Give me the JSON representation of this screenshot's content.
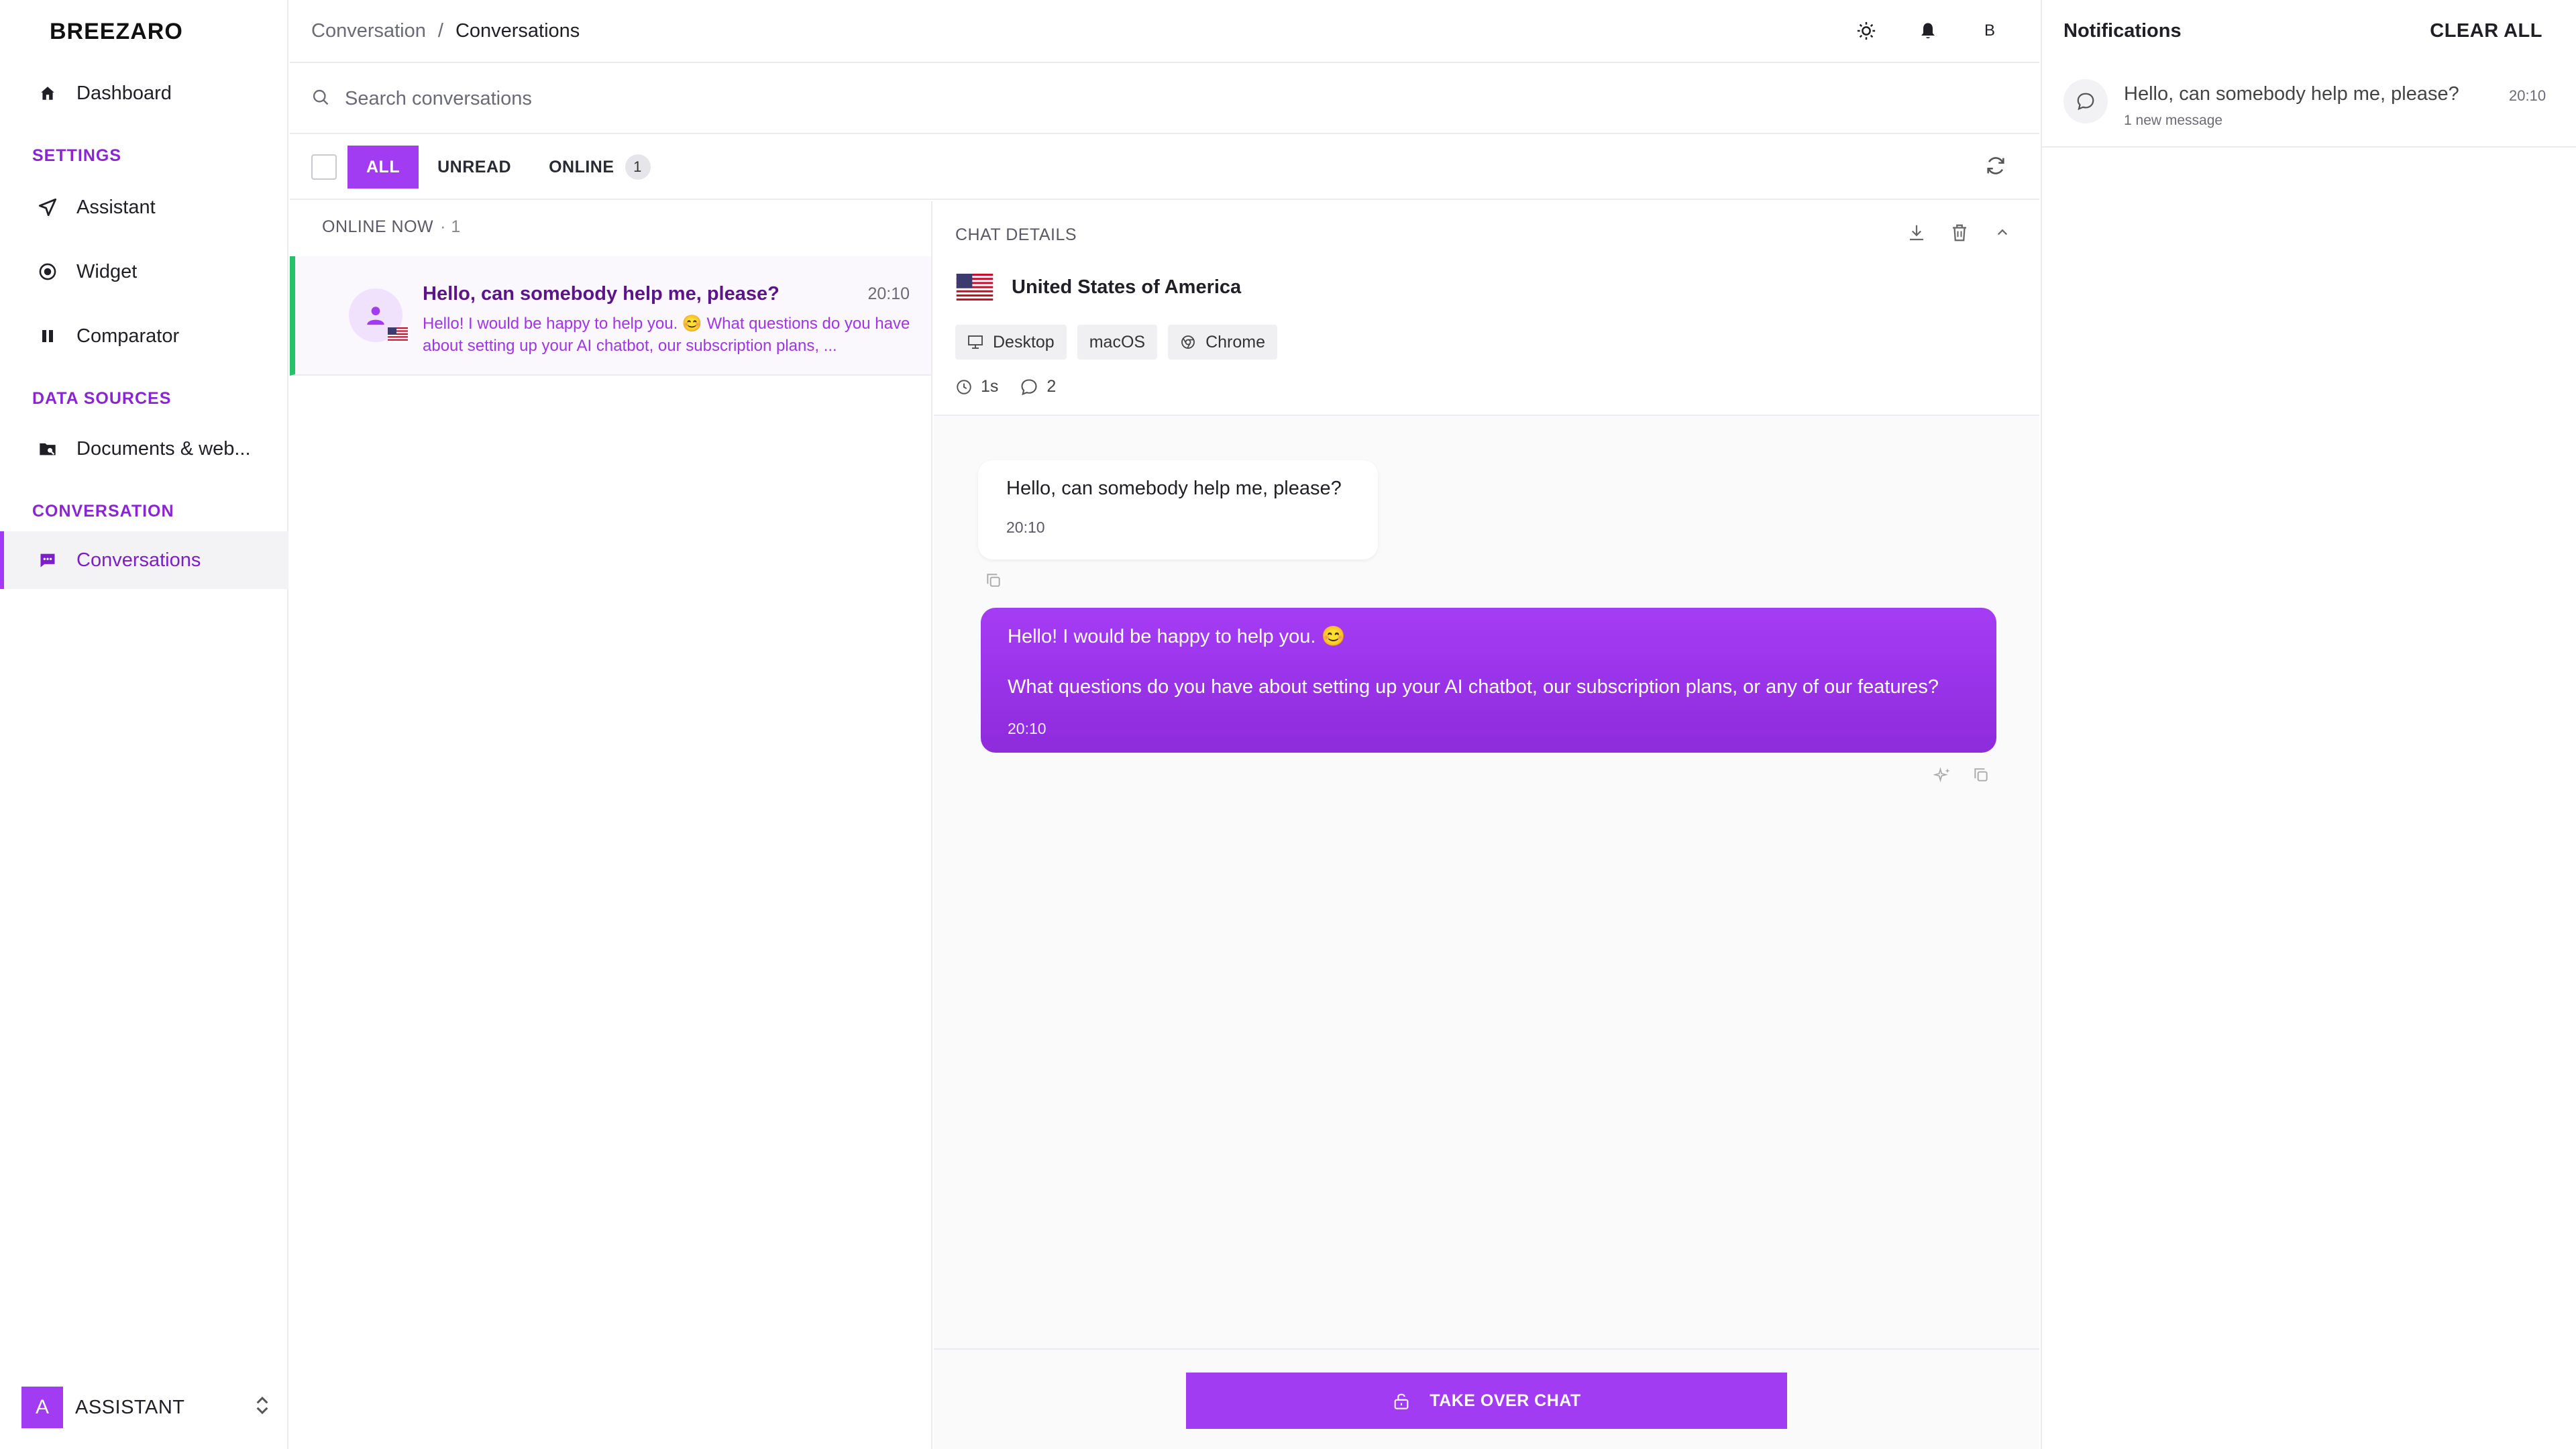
{
  "app": {
    "logo": "BREEZARO"
  },
  "sidebar": {
    "dashboard": "Dashboard",
    "sections": {
      "settings": "SETTINGS",
      "data_sources": "DATA SOURCES",
      "conversation": "CONVERSATION"
    },
    "items": {
      "assistant": "Assistant",
      "widget": "Widget",
      "comparator": "Comparator",
      "documents": "Documents & web...",
      "conversations": "Conversations"
    },
    "account": {
      "initial": "A",
      "name": "ASSISTANT"
    }
  },
  "header": {
    "breadcrumb_parent": "Conversation",
    "breadcrumb_sep": "/",
    "breadcrumb_current": "Conversations",
    "user_initial": "B"
  },
  "search": {
    "placeholder": "Search conversations"
  },
  "filters": {
    "all": "ALL",
    "unread": "UNREAD",
    "online": "ONLINE",
    "online_count": "1"
  },
  "list": {
    "online_now_label": "ONLINE NOW",
    "online_now_count": "· 1",
    "items": [
      {
        "title": "Hello, can somebody help me, please?",
        "time": "20:10",
        "preview": "Hello! I would be happy to help you. 😊 What questions do you have about setting up your AI chatbot, our subscription plans, ..."
      }
    ]
  },
  "details": {
    "label": "CHAT DETAILS",
    "country": "United States of America",
    "chips": {
      "device": "Desktop",
      "os": "macOS",
      "browser": "Chrome"
    },
    "duration": "1s",
    "message_count": "2"
  },
  "messages": {
    "user": {
      "text": "Hello, can somebody help me, please?",
      "time": "20:10"
    },
    "bot": {
      "line1": "Hello! I would be happy to help you. 😊",
      "line2": "What questions do you have about setting up your AI chatbot, our subscription plans, or any of our features?",
      "time": "20:10"
    }
  },
  "footer": {
    "take_over": "TAKE OVER CHAT"
  },
  "notifications": {
    "title": "Notifications",
    "clear_all": "CLEAR ALL",
    "items": [
      {
        "text": "Hello, can somebody help me, please?",
        "time": "20:10",
        "sub": "1 new message"
      }
    ]
  },
  "colors": {
    "accent": "#a13cf2",
    "online": "#26c26a",
    "text": "#1f1f25"
  }
}
